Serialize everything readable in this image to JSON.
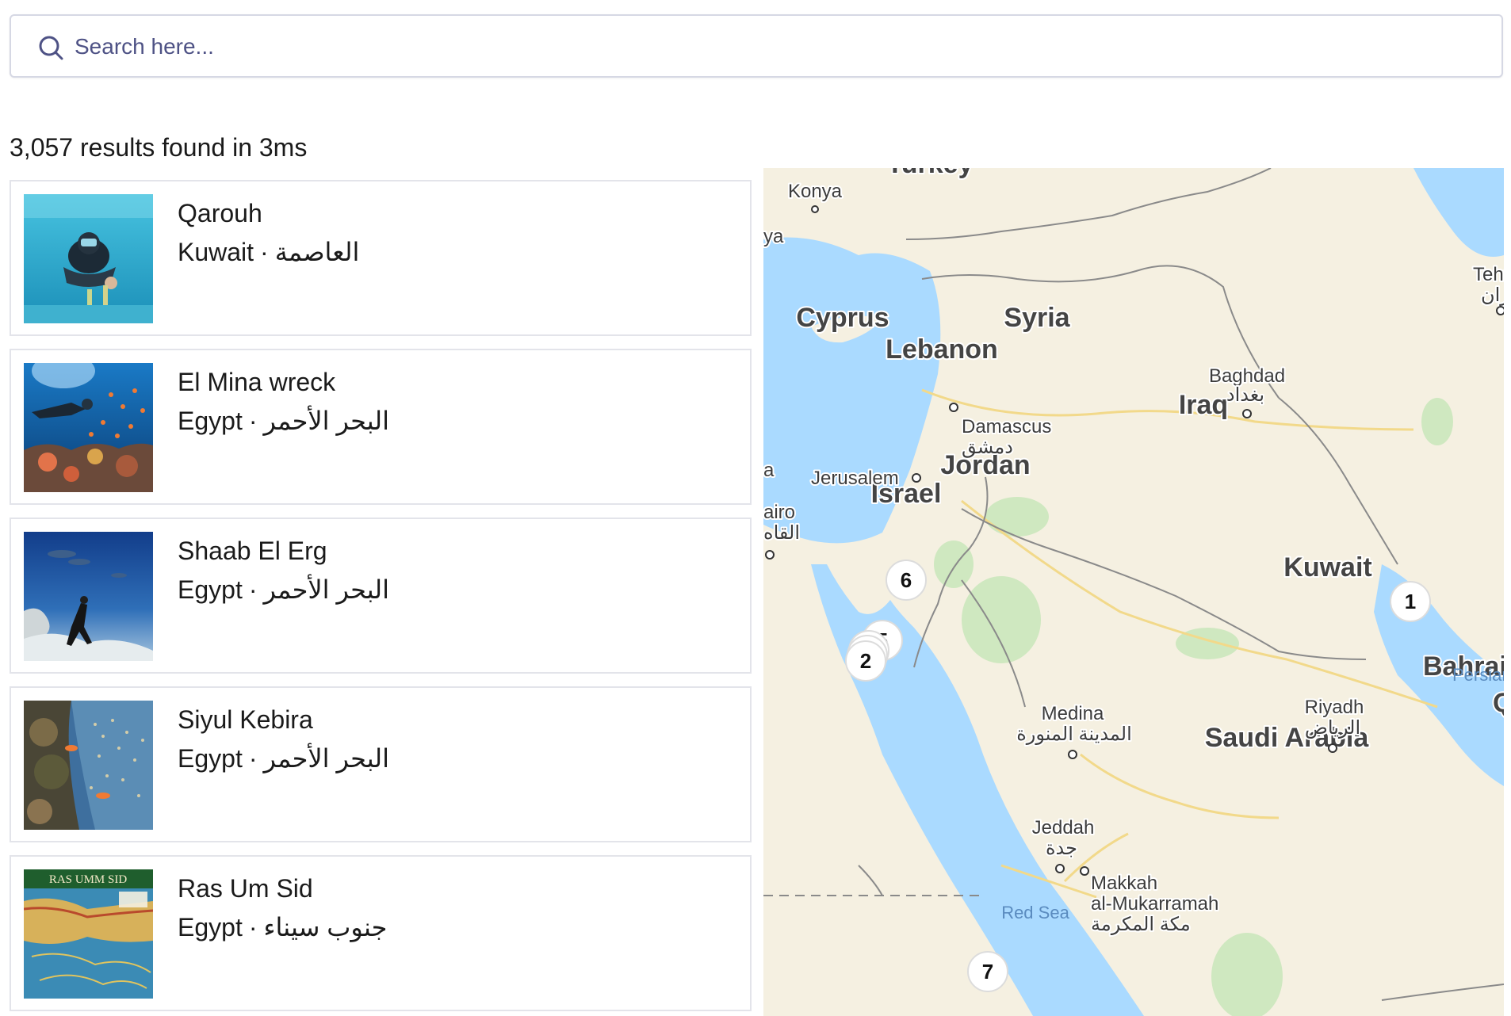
{
  "search": {
    "placeholder": "Search here...",
    "value": ""
  },
  "results_summary": "3,057 results found in 3ms",
  "results": [
    {
      "title": "Qarouh",
      "country": "Kuwait",
      "region": "العاصمة",
      "thumb": "diver-pool"
    },
    {
      "title": "El Mina wreck",
      "country": "Egypt",
      "region": "البحر الأحمر",
      "thumb": "diver-reef"
    },
    {
      "title": "Shaab El Erg",
      "country": "Egypt",
      "region": "البحر الأحمر",
      "thumb": "diver-dolphins"
    },
    {
      "title": "Siyul Kebira",
      "country": "Egypt",
      "region": "البحر الأحمر",
      "thumb": "coral-fish"
    },
    {
      "title": "Ras Um Sid",
      "country": "Egypt",
      "region": "جنوب سيناء",
      "thumb": "site-map",
      "thumb_text": "RAS UMM SID"
    }
  ],
  "separator": "·",
  "map": {
    "countries": [
      "Turkey",
      "Cyprus",
      "Syria",
      "Lebanon",
      "Jordan",
      "Israel",
      "Iraq",
      "Kuwait",
      "Saudi Arabia",
      "Bahrain",
      "Q"
    ],
    "cities": {
      "konya": "Konya",
      "ya": "ya",
      "tehran": "Tehr",
      "tehran_ar": "ران",
      "baghdad": "Baghdad",
      "baghdad_ar": "بغداد",
      "damascus": "Damascus",
      "damascus_ar": "دمشق",
      "jerusalem": "Jerusalem",
      "cairo": "airo",
      "cairo_ar": "القاه",
      "medina": "Medina",
      "medina_ar": "المدينة المنورة",
      "riyadh": "Riyadh",
      "riyadh_ar": "الرياض",
      "jeddah": "Jeddah",
      "jeddah_ar": "جدة",
      "makkah1": "Makkah",
      "makkah2": "al-Mukarramah",
      "makkah_ar": "مكة المكرمة",
      "a": "a"
    },
    "water": {
      "red_sea": "Red Sea",
      "persian": "Persian"
    },
    "markers": [
      "6",
      "5",
      "2",
      "1",
      "7"
    ],
    "colors": {
      "water": "#aadaff",
      "land": "#f5f0e1",
      "park": "#cfe8c0",
      "border": "#8a8a8a",
      "road": "#f2d98a"
    }
  }
}
